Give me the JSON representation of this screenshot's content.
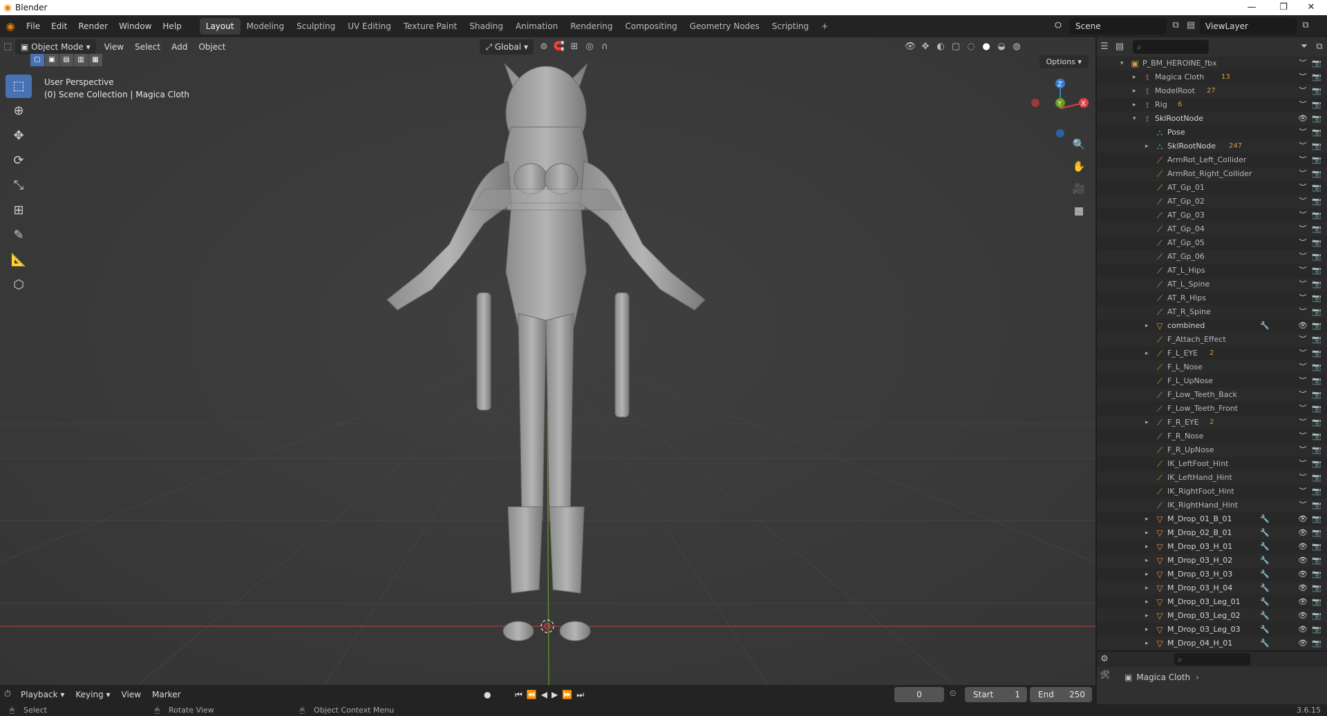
{
  "titlebar": {
    "title": "Blender",
    "minimize": "—",
    "restore": "❐",
    "close": "✕"
  },
  "menu": [
    "File",
    "Edit",
    "Render",
    "Window",
    "Help"
  ],
  "workspaces": [
    "Layout",
    "Modeling",
    "Sculpting",
    "UV Editing",
    "Texture Paint",
    "Shading",
    "Animation",
    "Rendering",
    "Compositing",
    "Geometry Nodes",
    "Scripting"
  ],
  "active_workspace": "Layout",
  "add_workspace": "+",
  "scene": {
    "label": "Scene",
    "view_layer": "ViewLayer"
  },
  "viewport": {
    "mode": "Object Mode",
    "menus": [
      "View",
      "Select",
      "Add",
      "Object"
    ],
    "orientation": "Global",
    "options_label": "Options",
    "info_line1": "User Perspective",
    "info_line2": "(0) Scene Collection | Magica Cloth"
  },
  "gizmo": {
    "z": "Z",
    "x": "X",
    "y": "Y"
  },
  "outliner": {
    "search_placeholder": "",
    "rows": [
      {
        "label": "P_BM_HEROINE_fbx",
        "indent": 0,
        "arrow": "▾",
        "icon": "collection",
        "dim": true
      },
      {
        "label": "Magica Cloth",
        "indent": 1,
        "arrow": "▸",
        "icon": "armature",
        "sub": "13",
        "dim": true
      },
      {
        "label": "ModelRoot",
        "indent": 1,
        "arrow": "▸",
        "icon": "armature",
        "sub": "27",
        "dim": true
      },
      {
        "label": "Rig",
        "indent": 1,
        "arrow": "▸",
        "icon": "armature",
        "sub": "6",
        "dim": true
      },
      {
        "label": "SklRootNode",
        "indent": 1,
        "arrow": "▾",
        "icon": "armature",
        "visible": true
      },
      {
        "label": "Pose",
        "indent": 2,
        "arrow": "",
        "icon": "pose"
      },
      {
        "label": "SklRootNode",
        "indent": 2,
        "arrow": "▸",
        "icon": "pose",
        "sub": "247"
      },
      {
        "label": "ArmRot_Left_Collider",
        "indent": 2,
        "arrow": "",
        "icon": "bone",
        "dim": true
      },
      {
        "label": "ArmRot_Right_Collider",
        "indent": 2,
        "arrow": "",
        "icon": "bone",
        "dim": true
      },
      {
        "label": "AT_Gp_01",
        "indent": 2,
        "arrow": "",
        "icon": "bone",
        "dim": true
      },
      {
        "label": "AT_Gp_02",
        "indent": 2,
        "arrow": "",
        "icon": "bone",
        "dim": true
      },
      {
        "label": "AT_Gp_03",
        "indent": 2,
        "arrow": "",
        "icon": "bone",
        "dim": true
      },
      {
        "label": "AT_Gp_04",
        "indent": 2,
        "arrow": "",
        "icon": "bone",
        "dim": true
      },
      {
        "label": "AT_Gp_05",
        "indent": 2,
        "arrow": "",
        "icon": "bone",
        "dim": true
      },
      {
        "label": "AT_Gp_06",
        "indent": 2,
        "arrow": "",
        "icon": "bone",
        "dim": true
      },
      {
        "label": "AT_L_Hips",
        "indent": 2,
        "arrow": "",
        "icon": "bone",
        "dim": true
      },
      {
        "label": "AT_L_Spine",
        "indent": 2,
        "arrow": "",
        "icon": "bone",
        "dim": true
      },
      {
        "label": "AT_R_Hips",
        "indent": 2,
        "arrow": "",
        "icon": "bone",
        "dim": true
      },
      {
        "label": "AT_R_Spine",
        "indent": 2,
        "arrow": "",
        "icon": "bone",
        "dim": true
      },
      {
        "label": "combined",
        "indent": 2,
        "arrow": "▸",
        "icon": "mesh",
        "visible": true,
        "mods": true
      },
      {
        "label": "F_Attach_Effect",
        "indent": 2,
        "arrow": "",
        "icon": "bone",
        "dim": true
      },
      {
        "label": "F_L_EYE",
        "indent": 2,
        "arrow": "▸",
        "icon": "bone",
        "sub": "2",
        "dim": true
      },
      {
        "label": "F_L_Nose",
        "indent": 2,
        "arrow": "",
        "icon": "bone",
        "dim": true
      },
      {
        "label": "F_L_UpNose",
        "indent": 2,
        "arrow": "",
        "icon": "bone",
        "dim": true
      },
      {
        "label": "F_Low_Teeth_Back",
        "indent": 2,
        "arrow": "",
        "icon": "bone",
        "dim": true
      },
      {
        "label": "F_Low_Teeth_Front",
        "indent": 2,
        "arrow": "",
        "icon": "bone",
        "dim": true
      },
      {
        "label": "F_R_EYE",
        "indent": 2,
        "arrow": "▸",
        "icon": "bone",
        "sub": "2",
        "dim": true
      },
      {
        "label": "F_R_Nose",
        "indent": 2,
        "arrow": "",
        "icon": "bone",
        "dim": true
      },
      {
        "label": "F_R_UpNose",
        "indent": 2,
        "arrow": "",
        "icon": "bone",
        "dim": true
      },
      {
        "label": "IK_LeftFoot_Hint",
        "indent": 2,
        "arrow": "",
        "icon": "bone",
        "dim": true
      },
      {
        "label": "IK_LeftHand_Hint",
        "indent": 2,
        "arrow": "",
        "icon": "bone",
        "dim": true
      },
      {
        "label": "IK_RightFoot_Hint",
        "indent": 2,
        "arrow": "",
        "icon": "bone",
        "dim": true
      },
      {
        "label": "IK_RightHand_Hint",
        "indent": 2,
        "arrow": "",
        "icon": "bone",
        "dim": true
      },
      {
        "label": "M_Drop_01_B_01",
        "indent": 2,
        "arrow": "▸",
        "icon": "mesh",
        "visible": true,
        "mods": true
      },
      {
        "label": "M_Drop_02_B_01",
        "indent": 2,
        "arrow": "▸",
        "icon": "mesh",
        "visible": true,
        "mods": true
      },
      {
        "label": "M_Drop_03_H_01",
        "indent": 2,
        "arrow": "▸",
        "icon": "mesh",
        "visible": true,
        "mods": true
      },
      {
        "label": "M_Drop_03_H_02",
        "indent": 2,
        "arrow": "▸",
        "icon": "mesh",
        "visible": true,
        "mods": true
      },
      {
        "label": "M_Drop_03_H_03",
        "indent": 2,
        "arrow": "▸",
        "icon": "mesh",
        "visible": true,
        "mods": true
      },
      {
        "label": "M_Drop_03_H_04",
        "indent": 2,
        "arrow": "▸",
        "icon": "mesh",
        "visible": true,
        "mods": true
      },
      {
        "label": "M_Drop_03_Leg_01",
        "indent": 2,
        "arrow": "▸",
        "icon": "mesh",
        "visible": true,
        "mods": true
      },
      {
        "label": "M_Drop_03_Leg_02",
        "indent": 2,
        "arrow": "▸",
        "icon": "mesh",
        "visible": true,
        "mods": true
      },
      {
        "label": "M_Drop_03_Leg_03",
        "indent": 2,
        "arrow": "▸",
        "icon": "mesh",
        "visible": true,
        "mods": true
      },
      {
        "label": "M_Drop_04_H_01",
        "indent": 2,
        "arrow": "▸",
        "icon": "mesh",
        "visible": true,
        "mods": true
      }
    ]
  },
  "properties": {
    "object_name": "Magica Cloth"
  },
  "timeline": {
    "menus": [
      "Playback",
      "Keying",
      "View",
      "Marker"
    ],
    "current_frame": "0",
    "start_label": "Start",
    "start": "1",
    "end_label": "End",
    "end": "250"
  },
  "statusbar": {
    "select": "Select",
    "rotate": "Rotate View",
    "context": "Object Context Menu",
    "version": "3.6.15"
  },
  "colors": {
    "accent": "#4772b3",
    "x_axis": "#e0404a",
    "y_axis": "#6c9b1e",
    "z_axis": "#3a7bd0",
    "bone": "#d79a44"
  }
}
